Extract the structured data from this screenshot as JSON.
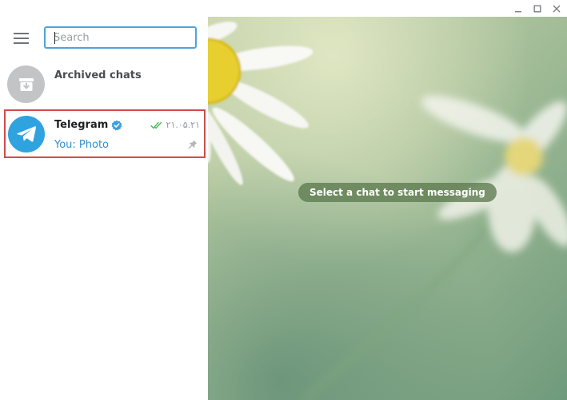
{
  "titlebar": {
    "minimize_icon": "minimize-icon",
    "maximize_icon": "maximize-icon",
    "close_icon": "close-icon"
  },
  "sidebar": {
    "menu_icon": "hamburger-menu-icon",
    "search": {
      "placeholder": "Search",
      "value": ""
    },
    "archived": {
      "title": "Archived chats",
      "icon": "archive-icon"
    },
    "chats": [
      {
        "name": "Telegram",
        "verified": true,
        "time": "۲۱.۰۵.۲۱",
        "read_status": "double-check-icon",
        "preview": "You: Photo",
        "pinned": true,
        "avatar_icon": "paper-plane-icon"
      }
    ]
  },
  "main": {
    "empty_message": "Select a chat to start messaging"
  },
  "colors": {
    "accent": "#4fa3dc",
    "telegram_blue": "#2fa3e0",
    "selection_outline": "#cf4b4b",
    "read_check": "#4dba5a",
    "pill_bg": "#5c7a4e"
  }
}
